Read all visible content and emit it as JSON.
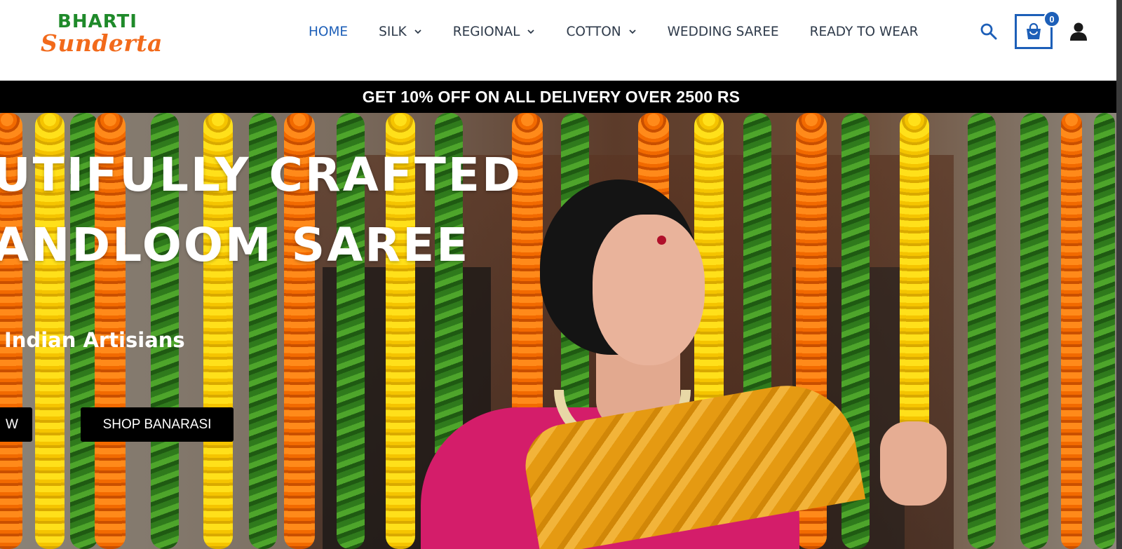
{
  "brand": {
    "logo_top": "BHARTI",
    "logo_bottom": "Sunderta",
    "green": "#1f8a2a",
    "orange": "#f26a1b"
  },
  "nav": {
    "items": [
      {
        "label": "HOME",
        "active": true,
        "dropdown": false
      },
      {
        "label": "SILK",
        "active": false,
        "dropdown": true
      },
      {
        "label": "REGIONAL",
        "active": false,
        "dropdown": true
      },
      {
        "label": "COTTON",
        "active": false,
        "dropdown": true
      },
      {
        "label": "WEDDING SAREE",
        "active": false,
        "dropdown": false
      },
      {
        "label": "READY TO WEAR",
        "active": false,
        "dropdown": false
      }
    ],
    "accent": "#1d5fb8"
  },
  "header_actions": {
    "search_icon": "search-icon",
    "cart_icon": "shopping-bag-icon",
    "cart_count": "0",
    "account_icon": "user-icon"
  },
  "promo": {
    "text": "GET 10% OFF ON ALL DELIVERY OVER 2500 RS"
  },
  "hero": {
    "line1": "UTIFULLY  CRAFTED",
    "line2": "ANDLOOM  SAREE",
    "subtitle": " Indian Artisians",
    "button_left": "W",
    "button_right": "SHOP BANARASI"
  }
}
